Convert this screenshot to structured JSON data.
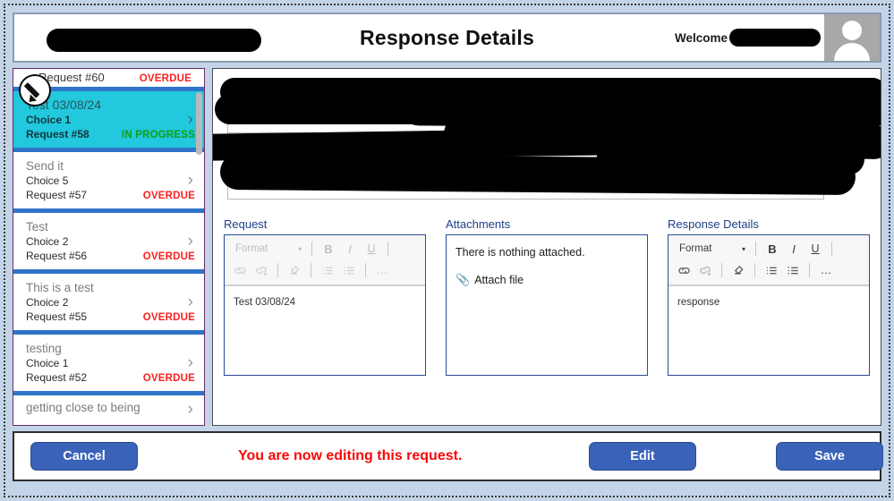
{
  "header": {
    "title": "Response Details",
    "welcome_label": "Welcome",
    "logo_redacted": true,
    "name_redacted": true
  },
  "sidebar": {
    "items": [
      {
        "title": "",
        "choice": "",
        "request_number": "Request #60",
        "status": "OVERDUE",
        "status_type": "overdue",
        "selected": false,
        "partial": true
      },
      {
        "title": "Test 03/08/24",
        "choice": "Choice 1",
        "request_number": "Request #58",
        "status": "IN PROGRESS",
        "status_type": "inprogress",
        "selected": true,
        "partial": false
      },
      {
        "title": "Send it",
        "choice": "Choice 5",
        "request_number": "Request #57",
        "status": "OVERDUE",
        "status_type": "overdue",
        "selected": false,
        "partial": false
      },
      {
        "title": "Test",
        "choice": "Choice 2",
        "request_number": "Request #56",
        "status": "OVERDUE",
        "status_type": "overdue",
        "selected": false,
        "partial": false
      },
      {
        "title": "This is a test",
        "choice": "Choice 2",
        "request_number": "Request #55",
        "status": "OVERDUE",
        "status_type": "overdue",
        "selected": false,
        "partial": false
      },
      {
        "title": "testing",
        "choice": "Choice 1",
        "request_number": "Request #52",
        "status": "OVERDUE",
        "status_type": "overdue",
        "selected": false,
        "partial": false
      },
      {
        "title": "getting close to being",
        "choice": "",
        "request_number": "",
        "status": "",
        "status_type": "",
        "selected": false,
        "partial": true
      }
    ],
    "chevron": "›"
  },
  "editors": {
    "request": {
      "label": "Request",
      "format_label": "Format",
      "caret": "▾",
      "bold": "B",
      "italic": "I",
      "underline": "U",
      "overflow": "…",
      "content": "Test 03/08/24",
      "enabled": false
    },
    "attachments": {
      "label": "Attachments",
      "empty_text": "There is nothing attached.",
      "attach_link": "Attach file",
      "clip_icon": "📎"
    },
    "response": {
      "label": "Response Details",
      "format_label": "Format",
      "caret": "▾",
      "bold": "B",
      "italic": "I",
      "underline": "U",
      "overflow": "…",
      "content": "response",
      "enabled": true
    }
  },
  "footer": {
    "cancel_label": "Cancel",
    "message": "You are now editing this request.",
    "edit_label": "Edit",
    "save_label": "Save"
  },
  "colors": {
    "accent_blue": "#3a62b8",
    "selected_cyan": "#22c8dd",
    "overdue_red": "#fc2020",
    "inprogress_green": "#10a010",
    "message_red": "#fb0606",
    "label_blue": "#1d3f86"
  }
}
